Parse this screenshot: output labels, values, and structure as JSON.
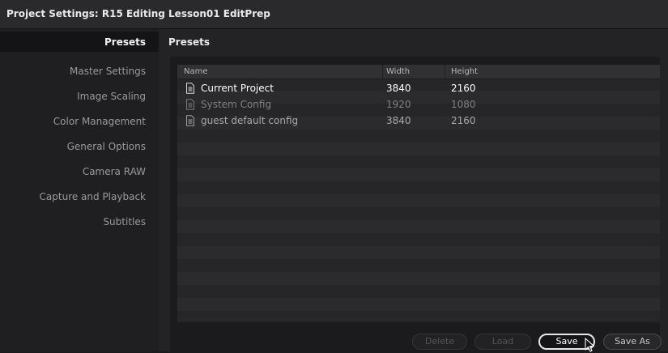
{
  "window": {
    "title": "Project Settings:  R15 Editing Lesson01 EditPrep"
  },
  "sidebar": {
    "items": [
      {
        "label": "Presets",
        "active": true
      },
      {
        "label": "Master Settings"
      },
      {
        "label": "Image Scaling"
      },
      {
        "label": "Color Management"
      },
      {
        "label": "General Options"
      },
      {
        "label": "Camera RAW"
      },
      {
        "label": "Capture and Playback"
      },
      {
        "label": "Subtitles"
      }
    ]
  },
  "main": {
    "heading": "Presets",
    "table": {
      "columns": [
        "Name",
        "Width",
        "Height"
      ],
      "rows": [
        {
          "name": "Current Project",
          "width": "3840",
          "height": "2160",
          "highlight": true
        },
        {
          "name": "System Config",
          "width": "1920",
          "height": "1080"
        },
        {
          "name": "guest default config",
          "width": "3840",
          "height": "2160"
        }
      ]
    },
    "buttons": {
      "delete": "Delete",
      "load": "Load",
      "save": "Save",
      "save_as": "Save As"
    }
  },
  "icons": {
    "row_icon": "document-icon",
    "pointer": "mouse-pointer-icon"
  },
  "colors": {
    "background": "#1b1b1d",
    "titlebar": "#2a2a2d",
    "text_primary": "#f0f0f0",
    "text_secondary": "#9a9a9c"
  }
}
